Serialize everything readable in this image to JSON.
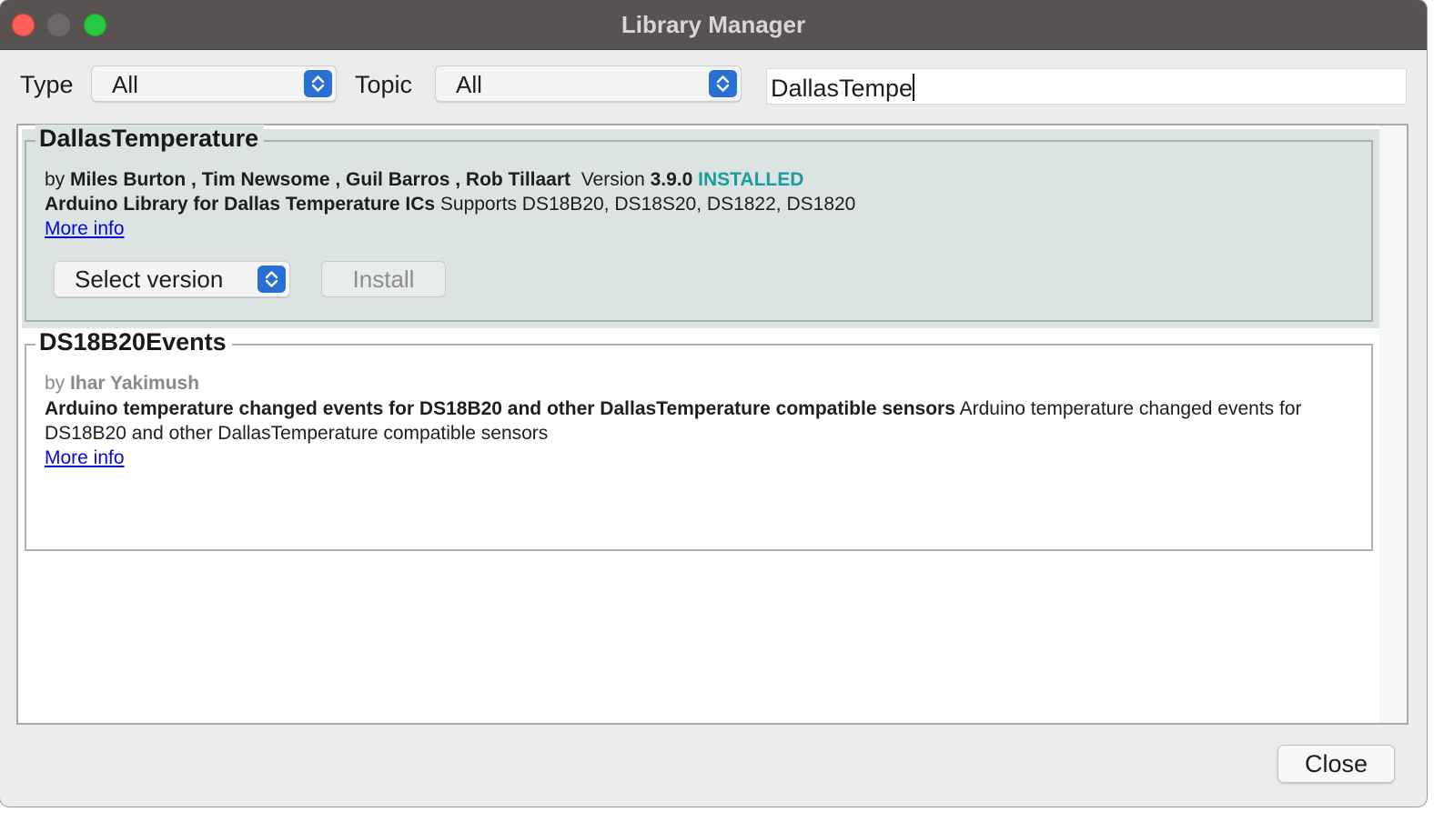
{
  "window": {
    "title": "Library Manager"
  },
  "filters": {
    "type_label": "Type",
    "type_value": "All",
    "topic_label": "Topic",
    "topic_value": "All",
    "search_value": "DallasTempe"
  },
  "libraries": [
    {
      "name": "DallasTemperature",
      "by": "by",
      "authors": "Miles Burton , Tim Newsome , Guil Barros , Rob Tillaart",
      "version_label": "Version",
      "version": "3.9.0",
      "status": "INSTALLED",
      "summary": "Arduino Library for Dallas Temperature ICs",
      "description": "Supports DS18B20, DS18S20, DS1822, DS1820",
      "more_info": "More info",
      "select_version": "Select version",
      "install": "Install"
    },
    {
      "name": "DS18B20Events",
      "by": "by",
      "authors": "Ihar Yakimush",
      "summary": "Arduino temperature changed events for DS18B20 and other DallasTemperature compatible sensors",
      "description": "Arduino temperature changed events for DS18B20 and other DallasTemperature compatible sensors",
      "more_info": "More info"
    }
  ],
  "footer": {
    "close_label": "Close"
  },
  "colors": {
    "titlebar": "#585352",
    "accent_blue": "#2a6fd6",
    "installed": "#1a9c9c",
    "selected_row": "#dce3e3",
    "link": "#0a0ad8"
  },
  "icons": {
    "window_close": "close-icon",
    "window_minimize": "minimize-icon",
    "window_maximize": "maximize-icon",
    "combo_arrows": "chevron-up-down-icon"
  }
}
